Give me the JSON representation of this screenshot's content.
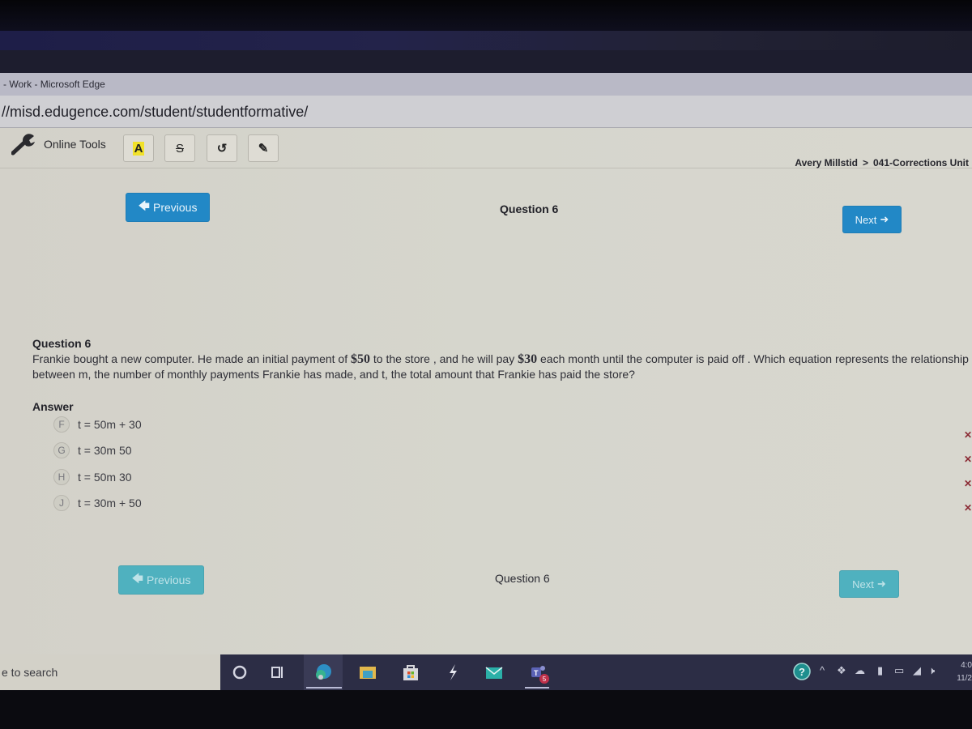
{
  "browser": {
    "window_title": "- Work - Microsoft Edge",
    "address": "//misd.edugence.com/student/studentformative/"
  },
  "toolbar": {
    "online_tools_label": "Online Tools",
    "highlight_label": "A",
    "strike_label": "S",
    "undo_glyph": "↺",
    "pencil_glyph": "✎"
  },
  "breadcrumb": {
    "student": "Avery Millstid",
    "separator": ">",
    "assessment": "041-Corrections Unit"
  },
  "nav_top": {
    "previous_label": "Previous",
    "previous_arrow": "🡄",
    "question_label": "Question 6",
    "next_label": "Next",
    "next_arrow": "➜"
  },
  "question": {
    "title": "Question 6",
    "text_part1": "Frankie bought a new computer. He made an initial payment of ",
    "amount1": "$50",
    "text_part2": " to the store , and he will pay ",
    "amount2": "$30",
    "text_part3": " each month until the computer is paid off . Which equation represents the relationship between m, the number of monthly payments Frankie has made, and t, the total amount that Frankie has paid the store?"
  },
  "answer": {
    "label": "Answer",
    "choices": [
      {
        "letter": "F",
        "equation": "t = 50m + 30",
        "mark": "✕"
      },
      {
        "letter": "G",
        "equation": "t = 30m 50",
        "mark": "✕"
      },
      {
        "letter": "H",
        "equation": "t = 50m 30",
        "mark": "✕"
      },
      {
        "letter": "J",
        "equation": "t = 30m + 50",
        "mark": "✕"
      }
    ]
  },
  "nav_bottom": {
    "previous_label": "Previous",
    "previous_arrow": "🡄",
    "question_label": "Question 6",
    "next_label": "Next",
    "next_arrow": "➜"
  },
  "taskbar": {
    "search_placeholder": "e to search",
    "teams_badge": "5",
    "clock_time": "4:0",
    "clock_date": "11/2"
  },
  "colors": {
    "primary_button": "#2288c6",
    "faded_button": "#4fb1bf",
    "highlight": "#f1e12a",
    "incorrect_mark": "#8b2a34"
  }
}
